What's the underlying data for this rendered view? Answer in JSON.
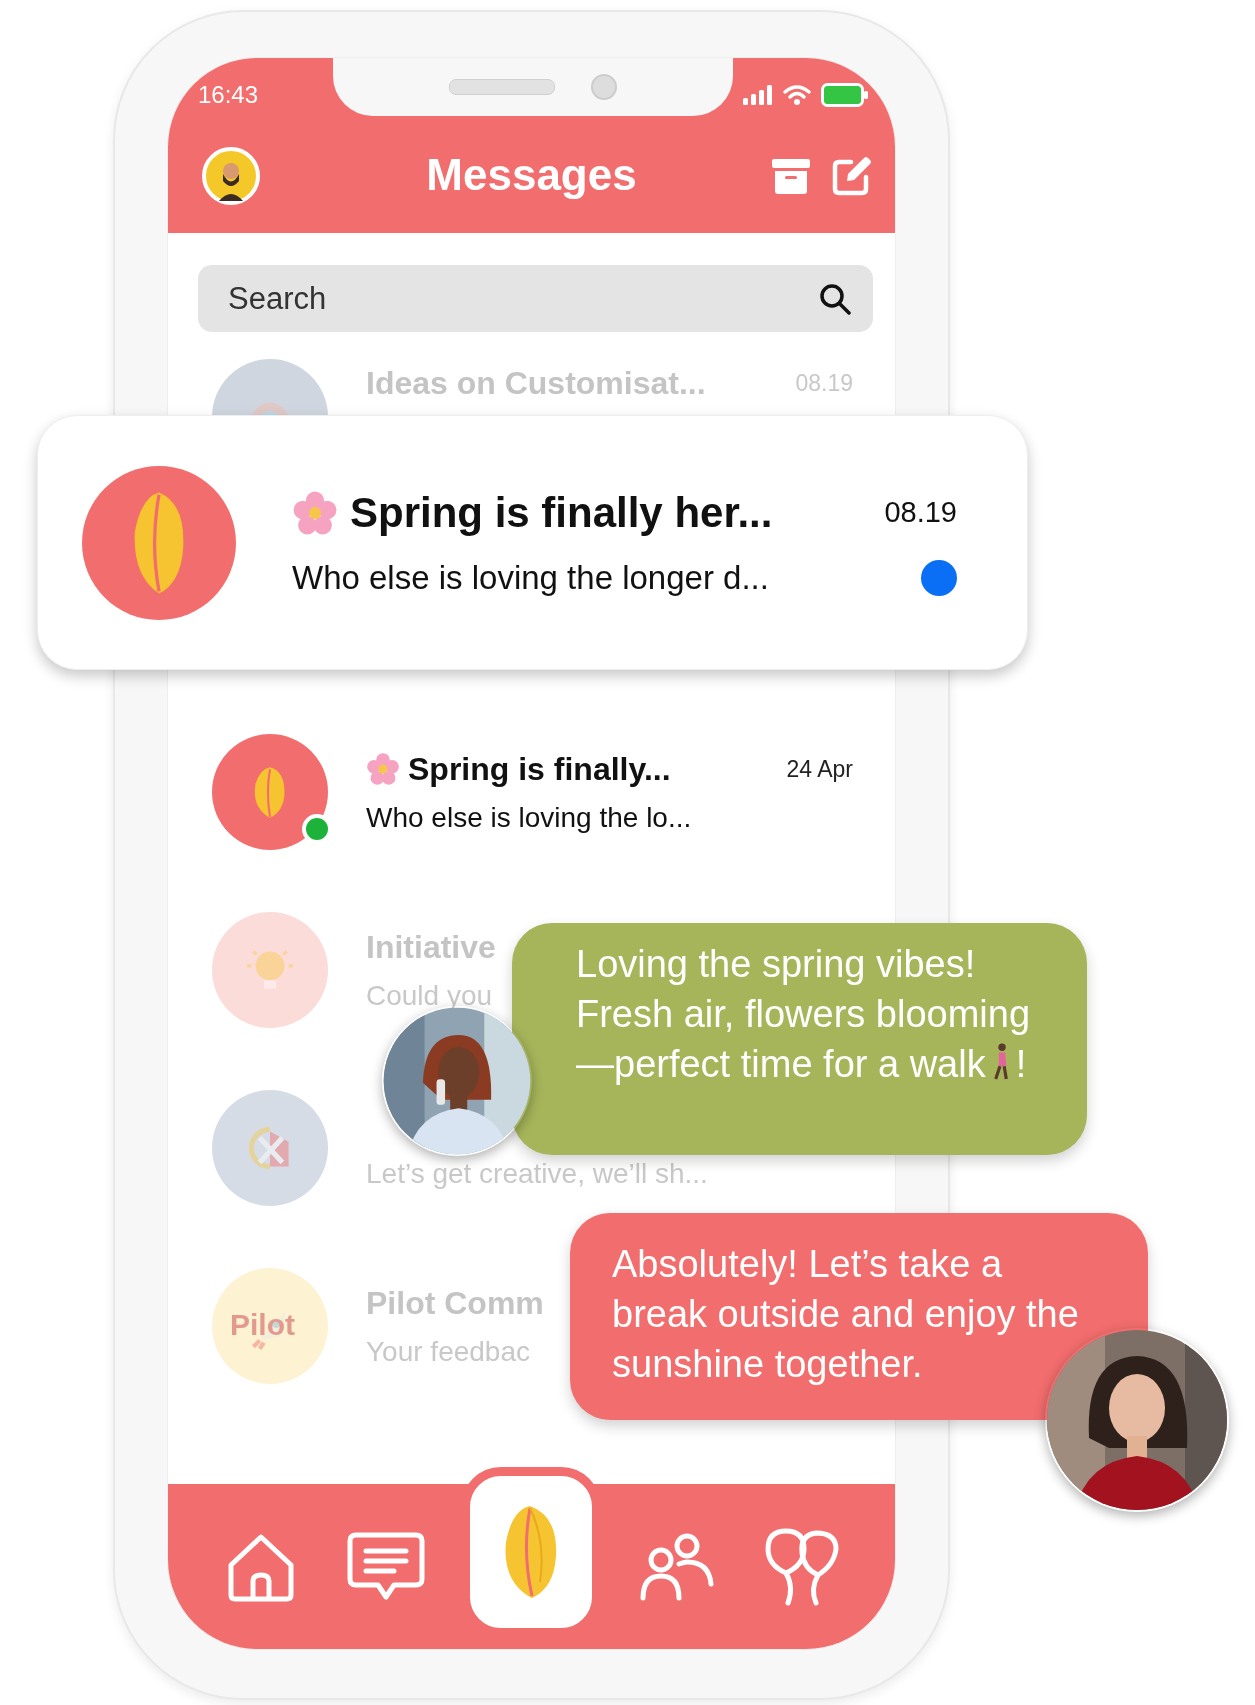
{
  "status_bar": {
    "time": "16:43"
  },
  "header": {
    "title": "Messages"
  },
  "search": {
    "placeholder": "Search"
  },
  "featured": {
    "title": "Spring is finally her...",
    "preview": "Who else is loving the longer d...",
    "time": "08.19",
    "flower": true,
    "unread": true,
    "avatar": {
      "kind": "tulip",
      "color": "#f26d6d"
    }
  },
  "conversations": [
    {
      "title": "Ideas on Customisat...",
      "time": "08.19",
      "faded": true,
      "online": false,
      "avatar": {
        "kind": "palette",
        "color": "#cfd6df"
      }
    },
    {
      "title": "Spring is finally...",
      "preview": "Who else is loving the lo...",
      "time": "24 Apr",
      "flower": true,
      "faded": false,
      "online": true,
      "avatar": {
        "kind": "tulip",
        "color": "#f26d6d"
      }
    },
    {
      "title": "Initiative",
      "preview": "Could you",
      "faded": true,
      "online": false,
      "avatar": {
        "kind": "bulb",
        "color": "#fbdcd9"
      }
    },
    {
      "preview": "Let’s get creative, we’ll sh...",
      "faded": true,
      "online": false,
      "avatar": {
        "kind": "tools",
        "color": "#d5dce5"
      }
    },
    {
      "title": "Pilot Comm",
      "preview": "Your feedbac",
      "faded": true,
      "online": false,
      "avatar": {
        "kind": "rocket",
        "color": "#fdf2d2",
        "label": "Pilot"
      }
    }
  ],
  "messages": [
    {
      "kind": "received",
      "color": "#a6b55a",
      "text": "Loving the spring vibes! Fresh air, flowers blooming—perfect time for a walk",
      "text_end": "!"
    },
    {
      "kind": "sent",
      "color": "#f26d6d",
      "text": "Absolutely! Let’s take a break outside and enjoy the sunshine together."
    }
  ],
  "nav": [
    {
      "kind": "home",
      "selected": false
    },
    {
      "kind": "chat",
      "selected": false
    },
    {
      "kind": "tulip",
      "selected": true
    },
    {
      "kind": "people",
      "selected": false
    },
    {
      "kind": "balloons",
      "selected": false
    }
  ]
}
